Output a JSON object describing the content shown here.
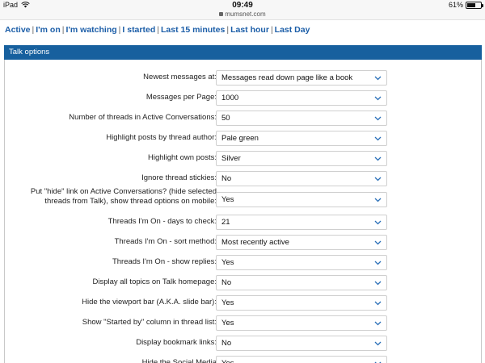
{
  "status_bar": {
    "device": "iPad",
    "time": "09:49",
    "url": "mumsnet.com",
    "battery_text": "61%",
    "battery_level": 0.61
  },
  "nav": {
    "links": [
      "Active",
      "I'm on",
      "I'm watching",
      "I started",
      "Last 15 minutes",
      "Last hour",
      "Last Day"
    ],
    "separator": "|"
  },
  "panel": {
    "title": "Talk options",
    "header_color": "#17609e"
  },
  "options": [
    {
      "label": "Newest messages at:",
      "value": "Messages read down page like a book"
    },
    {
      "label": "Messages per Page:",
      "value": "1000"
    },
    {
      "label": "Number of threads in Active Conversations:",
      "value": "50"
    },
    {
      "label": "Highlight posts by thread author:",
      "value": "Pale green"
    },
    {
      "label": "Highlight own posts:",
      "value": "Silver"
    },
    {
      "label": "Ignore thread stickies:",
      "value": "No"
    },
    {
      "label": "Put \"hide\" link on Active Conversations? (hide selected threads from Talk), show thread options on mobile:",
      "value": "Yes"
    },
    {
      "label": "Threads I'm On - days to check:",
      "value": "21"
    },
    {
      "label": "Threads I'm On - sort method:",
      "value": "Most recently active"
    },
    {
      "label": "Threads I'm On - show replies:",
      "value": "Yes"
    },
    {
      "label": "Display all topics on Talk homepage:",
      "value": "No"
    },
    {
      "label": "Hide the viewport bar (A.K.A. slide bar):",
      "value": "Yes"
    },
    {
      "label": "Show \"Started by\" column in thread list:",
      "value": "Yes"
    },
    {
      "label": "Display bookmark links:",
      "value": "No"
    },
    {
      "label": "Hide the Social Media",
      "value": "Yes"
    }
  ]
}
